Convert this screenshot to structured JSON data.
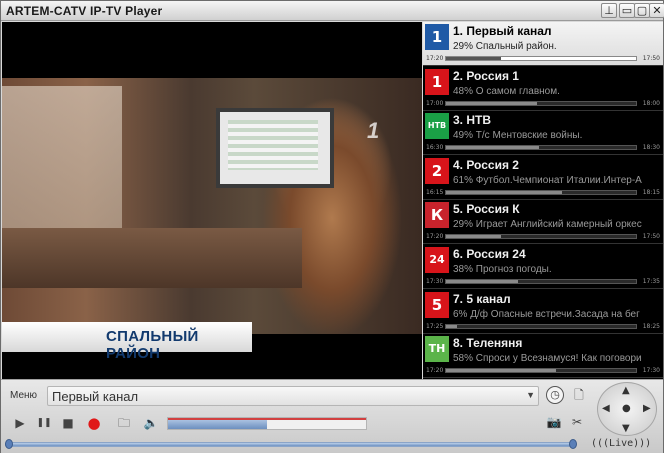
{
  "window": {
    "title": "ARTEM-CATV IP-TV Player",
    "pin_icon": "pin-icon",
    "minimize_glyph": "▭",
    "maximize_glyph": "▢",
    "close_glyph": "✕"
  },
  "video": {
    "chyron": "СПАЛЬНЫЙ РАЙОН",
    "watermark": "1"
  },
  "channels": [
    {
      "name": "1. Первый канал",
      "program": "29% Спальный район.",
      "start": "17:20",
      "end": "17:50",
      "progress": 0.29,
      "logo_text": "1",
      "logo_color": "#1f5aa6",
      "selected": true
    },
    {
      "name": "2. Россия 1",
      "program": "48% О самом главном.",
      "start": "17:00",
      "end": "18:00",
      "progress": 0.48,
      "logo_text": "1",
      "logo_color": "#d7141a",
      "selected": false
    },
    {
      "name": "3. НТВ",
      "program": "49% Т/с Ментовские войны.",
      "start": "16:30",
      "end": "18:30",
      "progress": 0.49,
      "logo_text": "НТВ",
      "logo_color": "#1aa046",
      "selected": false
    },
    {
      "name": "4. Россия 2",
      "program": "61% Футбол.Чемпионат Италии.Интер-А",
      "start": "16:15",
      "end": "18:15",
      "progress": 0.61,
      "logo_text": "2",
      "logo_color": "#d7141a",
      "selected": false
    },
    {
      "name": "5. Россия К",
      "program": "29% Играет Английский камерный оркес",
      "start": "17:20",
      "end": "17:50",
      "progress": 0.29,
      "logo_text": "К",
      "logo_color": "#c8232c",
      "selected": false
    },
    {
      "name": "6. Россия 24",
      "program": "38% Прогноз погоды.",
      "start": "17:30",
      "end": "17:35",
      "progress": 0.38,
      "logo_text": "24",
      "logo_color": "#d7141a",
      "selected": false
    },
    {
      "name": "7. 5 канал",
      "program": "6% Д/ф Опасные встречи.Засада на бег",
      "start": "17:25",
      "end": "18:25",
      "progress": 0.06,
      "logo_text": "5",
      "logo_color": "#d7141a",
      "selected": false
    },
    {
      "name": "8. Теленяня",
      "program": "58% Спроси у Всезнамуся! Как поговори",
      "start": "17:20",
      "end": "17:30",
      "progress": 0.58,
      "logo_text": "ТН",
      "logo_color": "#5bb44a",
      "selected": false
    }
  ],
  "controls": {
    "menu_label": "Меню",
    "current_channel": "Первый канал",
    "select_arrow": "▼",
    "clock_glyph": "◷",
    "doc_glyph": "🗋",
    "play_glyph": "▶",
    "pause_glyph": "❚❚",
    "stop_glyph": "■",
    "record_glyph": "●",
    "folder_glyph": "🗀",
    "volume_glyph": "🔈",
    "snapshot_glyph": "📷",
    "tools_glyph": "✂",
    "volume_level": 0.5,
    "live_label": "(((Live)))",
    "nav_up": "▲",
    "nav_down": "▼",
    "nav_left": "◀",
    "nav_right": "▶",
    "nav_center": "●"
  }
}
